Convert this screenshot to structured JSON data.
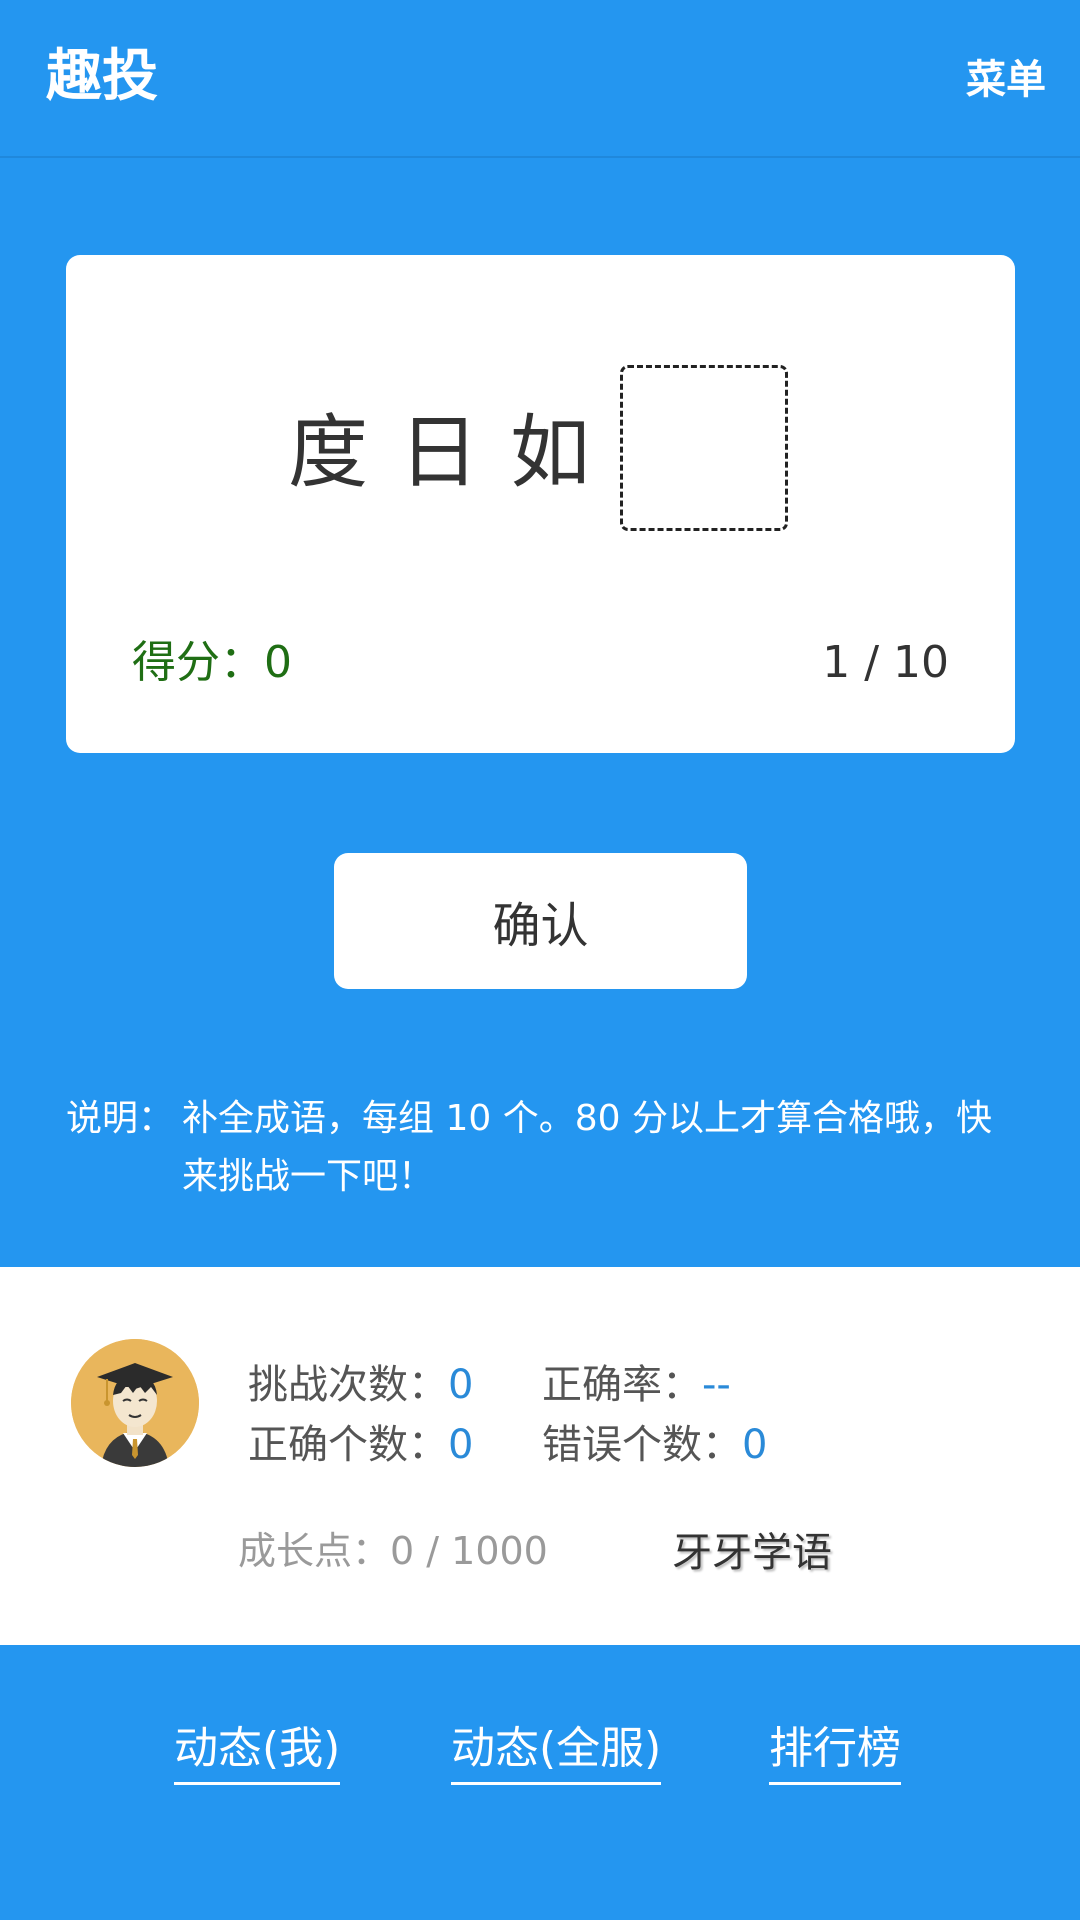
{
  "header": {
    "title": "趣投",
    "menu_label": "菜单"
  },
  "quiz": {
    "chars": [
      "度",
      "日",
      "如"
    ],
    "answer_value": "",
    "score_label": "得分：",
    "score_value": "0",
    "progress_text": "1 / 10"
  },
  "confirm_label": "确认",
  "instructions": {
    "label": "说明：",
    "text": "补全成语，每组 10 个。80 分以上才算合格哦，快来挑战一下吧！"
  },
  "stats": {
    "avatar_icon": "graduate-avatar-icon",
    "challenge_count_label": "挑战次数：",
    "challenge_count_value": "0",
    "accuracy_label": "正确率：",
    "accuracy_value": "--",
    "correct_count_label": "正确个数：",
    "correct_count_value": "0",
    "wrong_count_label": "错误个数：",
    "wrong_count_value": "0",
    "growth_label": "成长点：",
    "growth_value": "0 / 1000",
    "level_name": "牙牙学语"
  },
  "footer": {
    "links": [
      "动态(我)",
      "动态(全服)",
      "排行榜"
    ]
  },
  "colors": {
    "background_blue": "#2496f0",
    "score_green": "#1f6e14",
    "value_blue": "#2a8ad8",
    "avatar_bg": "#e9b65c"
  }
}
